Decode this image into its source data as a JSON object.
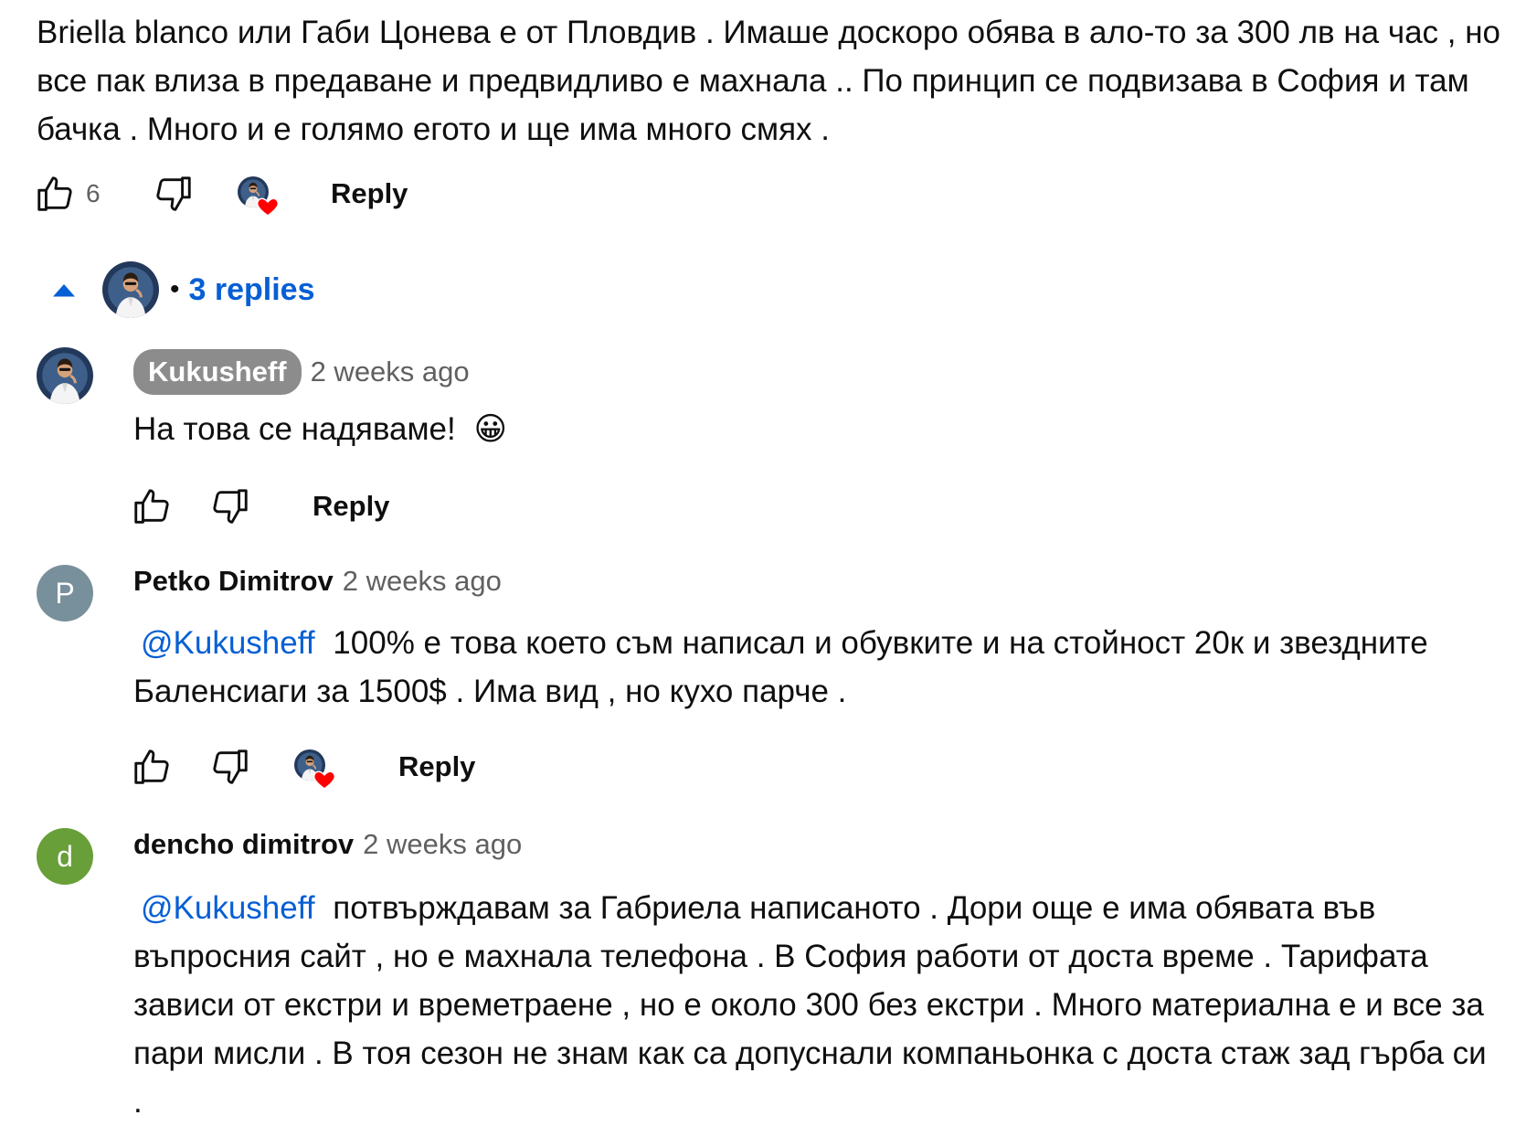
{
  "colors": {
    "accent": "#065fd4",
    "heart": "#ff0000",
    "avatar_p": "#78909c",
    "avatar_d": "#689f38",
    "author_badge": "#8c8c8c"
  },
  "main_comment": {
    "text": "Briella blanco или Габи Цонева е от Пловдив . Имаше доскоро обява в ало-то за 300 лв на час , но все пак влиза в предаване и предвидливо е махнала .. По принцип се подвизава в София и там бачка . Много и е голямо егото и ще има много смях .",
    "like_count": "6",
    "reply_label": "Reply",
    "icons": {
      "like": "thumb-up-icon",
      "dislike": "thumb-down-icon",
      "heart": "creator-heart-icon"
    }
  },
  "replies_toggle": {
    "label": "3 replies",
    "separator": "•",
    "icon": "caret-up-icon"
  },
  "replies": [
    {
      "author": "Kukusheff",
      "time": "2 weeks ago",
      "text": "На това се надяваме!",
      "emoji": "😀",
      "reply_label": "Reply"
    },
    {
      "author": "Petko Dimitrov",
      "avatar_letter": "P",
      "time": "2 weeks ago",
      "mention": "@Kukusheff",
      "text": "100% е това което съм написал и обувките и на стойност 20к и звездните Баленсиаги за 1500$ . Има вид , но кухо парче .",
      "reply_label": "Reply"
    },
    {
      "author": "dencho dimitrov",
      "avatar_letter": "d",
      "time": "2 weeks ago",
      "mention": "@Kukusheff",
      "text": "потвърждавам за Габриела написаното . Дори още е има обявата във въпросния сайт , но е махнала телефона . В София работи от доста време . Тарифата зависи от екстри и времетраене , но е около 300 без екстри . Много материална е и все за пари мисли  . В тоя сезон не знам как са допуснали компаньонка с доста стаж зад гърба си ."
    }
  ]
}
